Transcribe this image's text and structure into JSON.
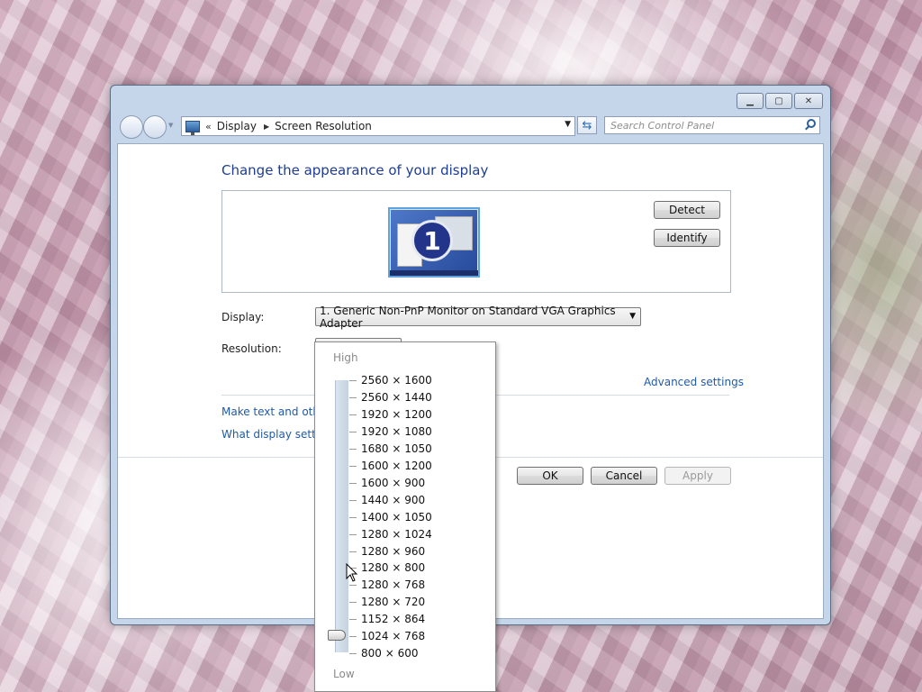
{
  "window": {
    "minimize_icon": "minimize-icon",
    "maximize_icon": "maximize-icon",
    "close_icon": "close-icon"
  },
  "address_bar": {
    "overflow": "«",
    "crumbs": [
      "Display",
      "Screen Resolution"
    ],
    "search_placeholder": "Search Control Panel"
  },
  "main": {
    "title": "Change the appearance of your display",
    "monitor_number": "1",
    "detect_label": "Detect",
    "identify_label": "Identify",
    "display_label": "Display:",
    "display_value": "1. Generic Non-PnP Monitor on Standard VGA Graphics Adapter",
    "resolution_label": "Resolution:",
    "advanced_link": "Advanced settings",
    "link_text_size": "Make text and other",
    "link_display_settings": "What display setting",
    "ok_label": "OK",
    "cancel_label": "Cancel",
    "apply_label": "Apply"
  },
  "resolution_popup": {
    "high_label": "High",
    "low_label": "Low",
    "options": [
      "2560 × 1600",
      "2560 × 1440",
      "1920 × 1200",
      "1920 × 1080",
      "1680 × 1050",
      "1600 × 1200",
      "1600 × 900",
      "1440 × 900",
      "1400 × 1050",
      "1280 × 1024",
      "1280 × 960",
      "1280 × 800",
      "1280 × 768",
      "1280 × 720",
      "1152 × 864",
      "1024 × 768",
      "800 × 600"
    ],
    "selected": "1024 × 768"
  }
}
